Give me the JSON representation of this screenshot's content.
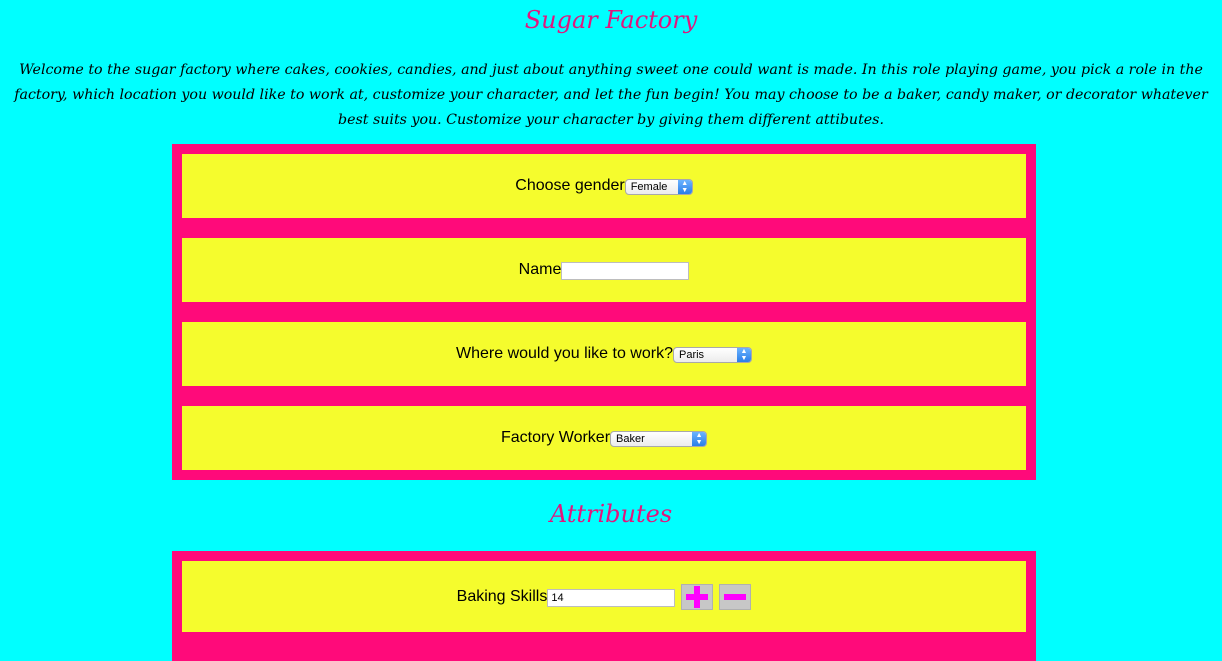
{
  "header": {
    "title": "Sugar Factory",
    "intro": "Welcome to the sugar factory where cakes, cookies, candies, and just about anything sweet one could want is made. In this role playing game, you pick a role in the factory, which location you would like to work at, customize your character, and let the fun begin! You may choose to be a baker, candy maker, or decorator whatever best suits you. Customize your character by giving them different attibutes."
  },
  "form": {
    "gender_label": "Choose gender",
    "gender_value": "Female",
    "name_label": "Name",
    "name_value": "",
    "location_label": "Where would you like to work?",
    "location_value": "Paris",
    "worker_label": "Factory Worker",
    "worker_value": "Baker"
  },
  "attributes": {
    "title": "Attributes",
    "baking_label": "Baking Skills",
    "baking_value": "14"
  },
  "colors": {
    "background": "#00ffff",
    "panel": "#ff0a7a",
    "row": "#f5fc2d",
    "heading": "#e0177e",
    "button_icon": "#ff00ff"
  },
  "icons": {
    "plus": "plus-icon",
    "minus": "minus-icon"
  }
}
